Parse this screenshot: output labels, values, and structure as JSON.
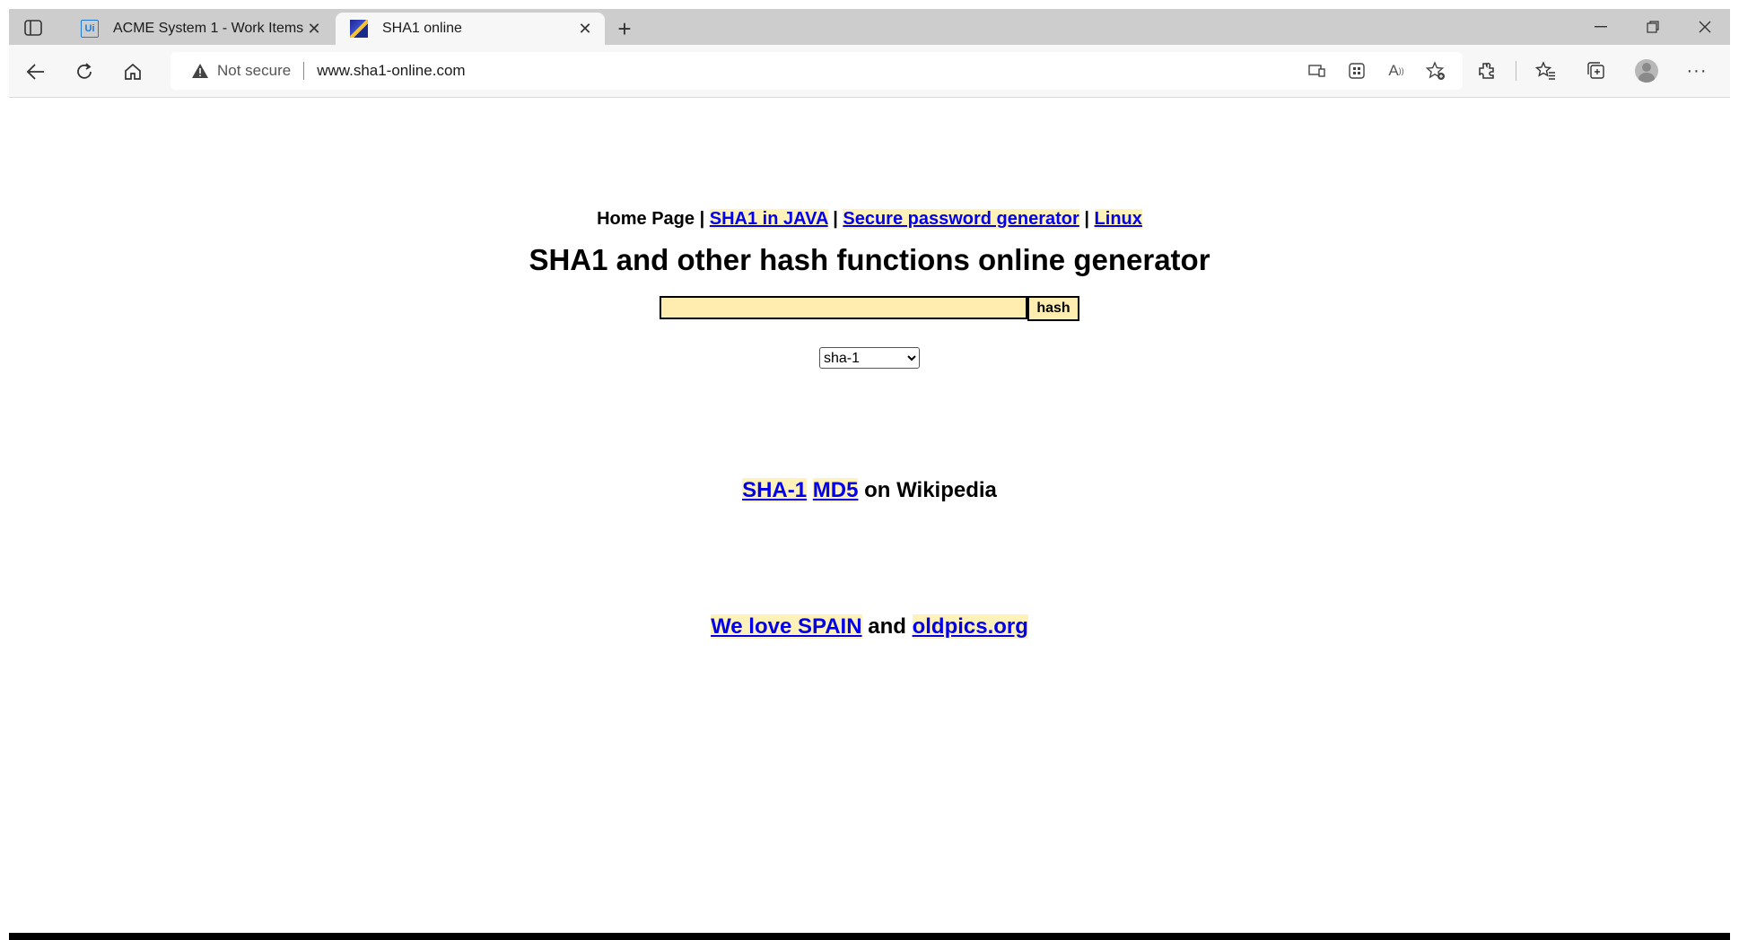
{
  "browser": {
    "tabs": [
      {
        "title": "ACME System 1 - Work Items",
        "favicon": "ui-icon",
        "active": false
      },
      {
        "title": "SHA1 online",
        "favicon": "sha1-site-icon",
        "active": true
      }
    ],
    "new_tab_symbol": "+",
    "address": {
      "security_label": "Not secure",
      "url": "www.sha1-online.com"
    }
  },
  "page": {
    "nav": {
      "home": "Home Page",
      "sep": "|",
      "links": [
        "SHA1 in JAVA",
        "Secure password generator",
        "Linux"
      ]
    },
    "heading": "SHA1 and other hash functions online generator",
    "form": {
      "input_value": "",
      "button_label": "hash",
      "algorithm_selected": "sha-1"
    },
    "wiki": {
      "link1": "SHA-1",
      "link2": "MD5",
      "suffix": "on Wikipedia"
    },
    "footer_links": {
      "link1": "We love SPAIN",
      "conj": "and",
      "link2": "oldpics.org"
    }
  },
  "colors": {
    "link": "#0000ee",
    "highlight": "#fff2b8",
    "input_bg": "#ffedb0"
  }
}
